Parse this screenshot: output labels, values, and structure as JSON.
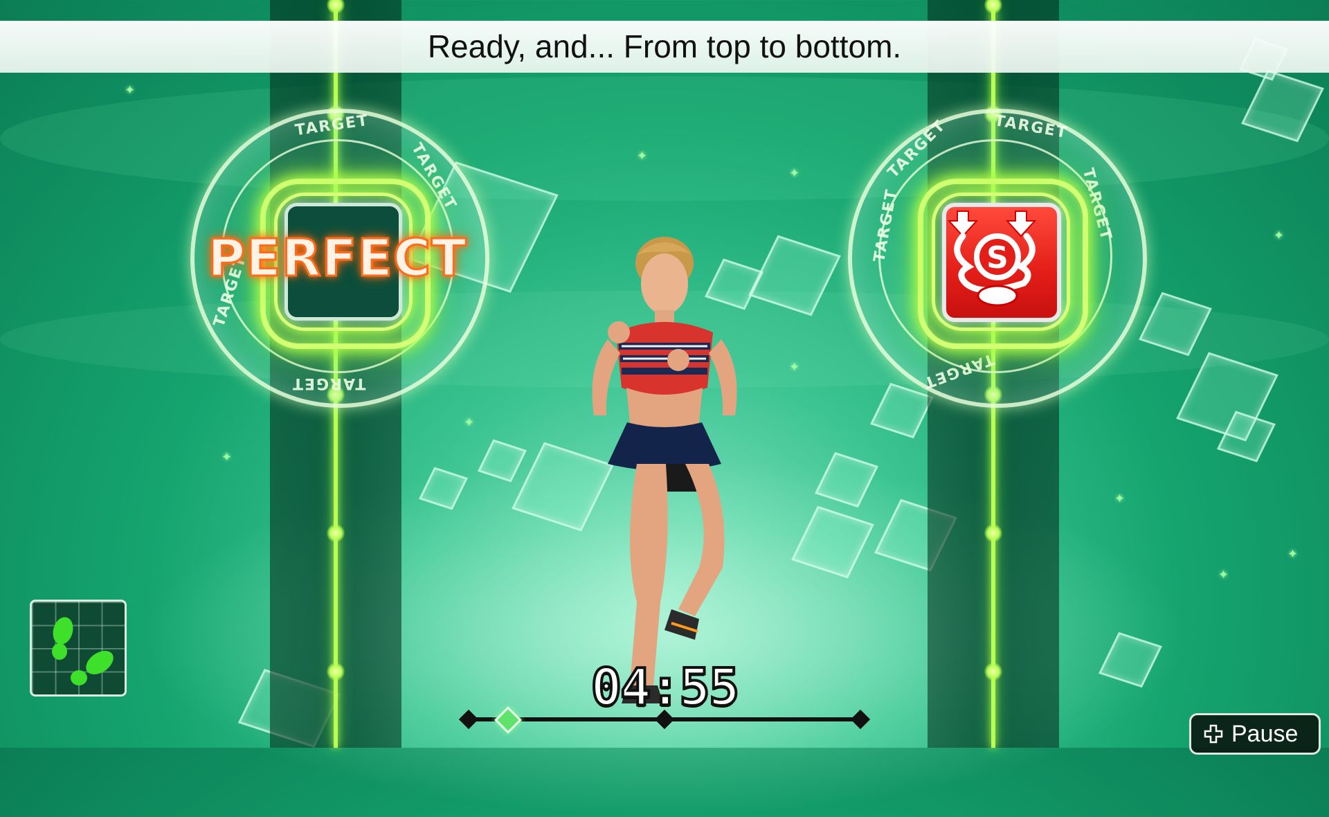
{
  "banner": {
    "instruction": "Ready, and...   From top to bottom."
  },
  "targets": {
    "left": {
      "ring_label": "TARGET",
      "feedback": "PERFECT"
    },
    "right": {
      "ring_label": "TARGET",
      "pad_icon": "squat-s-icon"
    }
  },
  "timer": {
    "remaining": "04:55"
  },
  "progress": {
    "fraction": 0.1
  },
  "footprint": {
    "icon": "footsteps-icon"
  },
  "pause": {
    "label": "Pause",
    "icon": "plus-button-icon"
  },
  "colors": {
    "neon_green": "#b9ff53",
    "perfect_orange": "#ff6a1c",
    "pad_red": "#e31d17"
  }
}
